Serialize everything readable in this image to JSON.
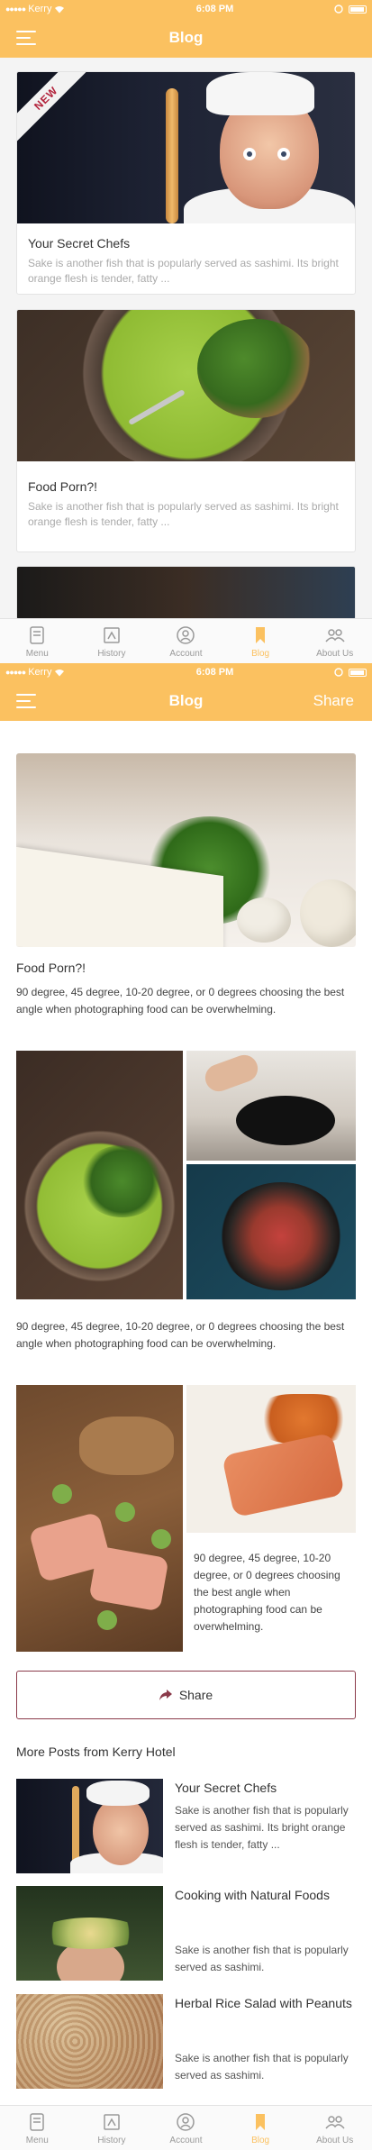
{
  "status_bar": {
    "carrier": "Kerry",
    "time": "6:08 PM"
  },
  "blog_list_screen": {
    "header_title": "Blog",
    "cards": [
      {
        "ribbon": "NEW",
        "title": "Your Secret Chefs",
        "excerpt": "Sake is another fish that is popularly served as sashimi. Its bright orange flesh is tender, fatty ..."
      },
      {
        "title": "Food Porn?!",
        "excerpt": "Sake is another fish that is popularly served as sashimi. Its bright orange flesh is tender, fatty ..."
      }
    ]
  },
  "article_screen": {
    "header_title": "Blog",
    "header_share": "Share",
    "article_title": "Food Porn?!",
    "paragraph_1": "90 degree, 45 degree, 10-20 degree, or 0 degrees choosing the best angle when photographing food can be overwhelming.",
    "paragraph_2": "90 degree, 45 degree, 10-20 degree, or 0 degrees choosing the best angle when photographing food can be overwhelming.",
    "paragraph_3": "90 degree, 45 degree, 10-20 degree, or 0 degrees choosing the best angle when photographing food can be overwhelming.",
    "share_button": "Share",
    "more_posts_title": "More Posts from Kerry Hotel",
    "more_posts": [
      {
        "title": "Your Secret Chefs",
        "excerpt": "Sake is another fish that is popularly served as sashimi. Its bright orange flesh is tender, fatty ..."
      },
      {
        "title": "Cooking with Natural Foods",
        "excerpt": "Sake is another fish that is popularly served as sashimi."
      },
      {
        "title": "Herbal Rice Salad with Peanuts",
        "excerpt": "Sake is another fish that is popularly served as sashimi."
      }
    ]
  },
  "tabbar": {
    "items": [
      {
        "label": "Menu",
        "icon": "menu-book-icon"
      },
      {
        "label": "History",
        "icon": "history-icon"
      },
      {
        "label": "Account",
        "icon": "account-icon"
      },
      {
        "label": "Blog",
        "icon": "bookmark-icon",
        "active": true
      },
      {
        "label": "About Us",
        "icon": "group-icon"
      }
    ]
  },
  "colors": {
    "accent": "#fbc160",
    "share_border": "#8b3a4a",
    "inactive_tab": "#999999"
  }
}
